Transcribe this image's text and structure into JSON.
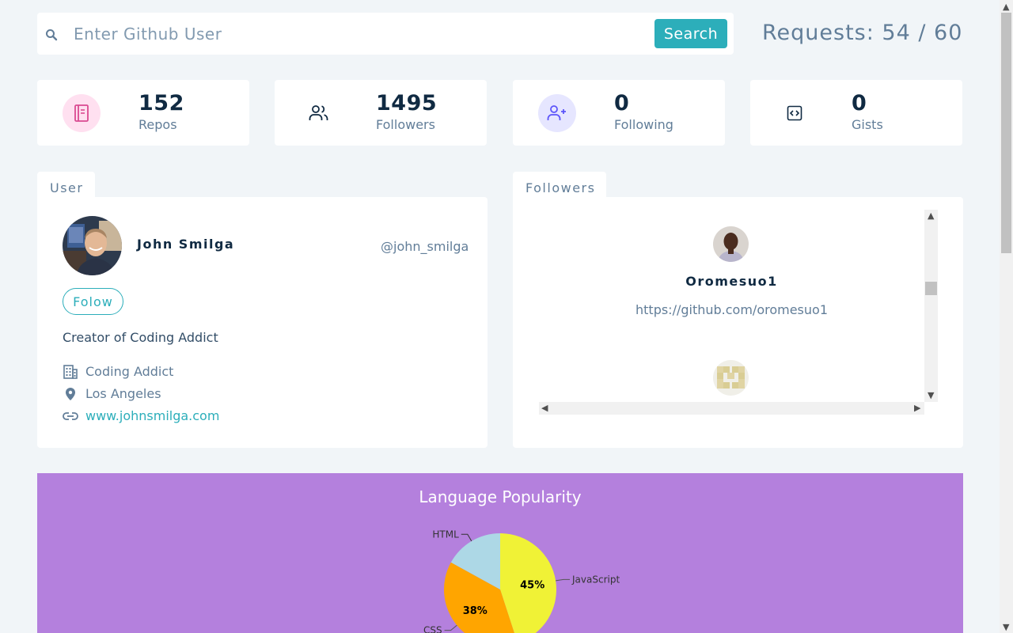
{
  "search": {
    "placeholder": "Enter Github User",
    "button_label": "Search",
    "requests_text": "Requests: 54 / 60"
  },
  "stats": [
    {
      "value": "152",
      "label": "Repos",
      "icon": "book-icon",
      "icon_color": "#da4a91",
      "icon_bg": "#ffe0f0"
    },
    {
      "value": "1495",
      "label": "Followers",
      "icon": "users-icon",
      "icon_color": "#102a42",
      "icon_bg": "#ffffff"
    },
    {
      "value": "0",
      "label": "Following",
      "icon": "user-plus-icon",
      "icon_color": "#5d55fa",
      "icon_bg": "#e6e6ff"
    },
    {
      "value": "0",
      "label": "Gists",
      "icon": "code-icon",
      "icon_color": "#102a42",
      "icon_bg": "#ffffff"
    }
  ],
  "user": {
    "tab_label": "User",
    "name": "John Smilga",
    "handle": "@john_smilga",
    "follow_label": "Folow",
    "bio": "Creator of Coding Addict",
    "company": "Coding Addict",
    "location": "Los Angeles",
    "blog": "www.johnsmilga.com"
  },
  "followers": {
    "tab_label": "Followers",
    "items": [
      {
        "name": "Oromesuo1",
        "url": "https://github.com/oromesuo1"
      }
    ]
  },
  "chart_data": {
    "type": "pie",
    "title": "Language Popularity",
    "categories": [
      "JavaScript",
      "CSS",
      "HTML"
    ],
    "values": [
      45,
      38,
      17
    ],
    "labels": [
      "45%",
      "38%",
      ""
    ],
    "colors": [
      "#f0f236",
      "#ffa500",
      "#add8e6"
    ]
  },
  "colors": {
    "accent": "#2caeba",
    "chart_background": "#b480dd"
  }
}
